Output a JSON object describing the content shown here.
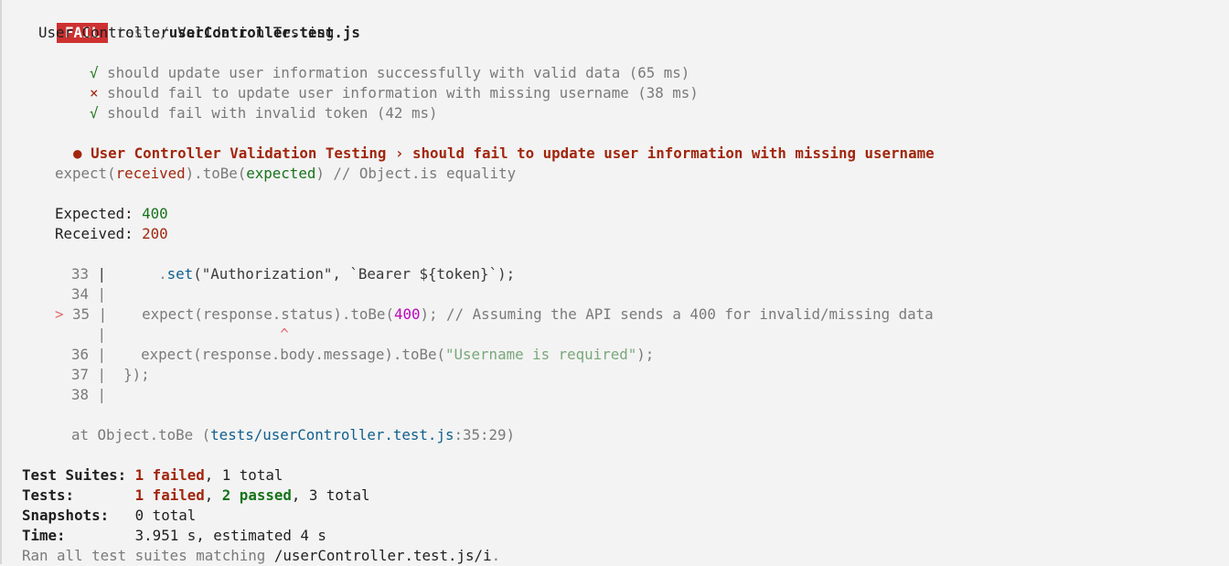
{
  "header": {
    "status_badge": "FAIL",
    "file_dir": "tests/",
    "file_name": "userController.test.js"
  },
  "suite": {
    "title": "User Controller Validation Testing",
    "tests": [
      {
        "status_icon": "√",
        "label": "should update user information successfully with valid data (65 ms)"
      },
      {
        "status_icon": "×",
        "label": "should fail to update user information with missing username (38 ms)"
      },
      {
        "status_icon": "√",
        "label": "should fail with invalid token (42 ms)"
      }
    ]
  },
  "failure": {
    "bullet": "●",
    "heading": "User Controller Validation Testing › should fail to update user information with missing username",
    "matcher": {
      "p1": "expect(",
      "received": "received",
      "p2": ").toBe(",
      "expected": "expected",
      "p3": ")",
      "comment": " // Object.is equality"
    },
    "expected_label": "Expected: ",
    "expected_value": "400",
    "received_label": "Received: ",
    "received_value": "200",
    "code": {
      "l33_num": "33",
      "l33_code": "      .set(\"Authorization\", `Bearer ${token}`);",
      "l34_num": "34",
      "l35_marker": ">",
      "l35_num": "35",
      "l35_a": "expect(response.status)",
      "l35_b": ".toBe(",
      "l35_c": "400",
      "l35_d": ");",
      "l35_e": " // Assuming the API sends a 400 for invalid/missing data",
      "caret": "^",
      "l36_num": "36",
      "l36_a": "expect(response.body.message)",
      "l36_b": ".toBe(",
      "l36_c": "\"Username is required\"",
      "l36_d": ");",
      "l37_num": "37",
      "l37_code": "});",
      "l38_num": "38",
      "sep": "|"
    },
    "stack_prefix": "at Object.toBe (",
    "stack_file": "tests/userController.test.js",
    "stack_pos": ":35:29)"
  },
  "summary": {
    "suites_label": "Test Suites:",
    "suites_failed": "1 failed",
    "suites_total": ", 1 total",
    "tests_label": "Tests:",
    "tests_failed": "1 failed",
    "tests_sep": ", ",
    "tests_passed": "2 passed",
    "tests_total": ", 3 total",
    "snapshots_label": "Snapshots:",
    "snapshots_value": "0 total",
    "time_label": "Time:",
    "time_value": "3.951 s, estimated 4 s",
    "ran_prefix": "Ran all test suites matching ",
    "ran_pattern": "/userController.test.js/i",
    "ran_suffix": "."
  }
}
